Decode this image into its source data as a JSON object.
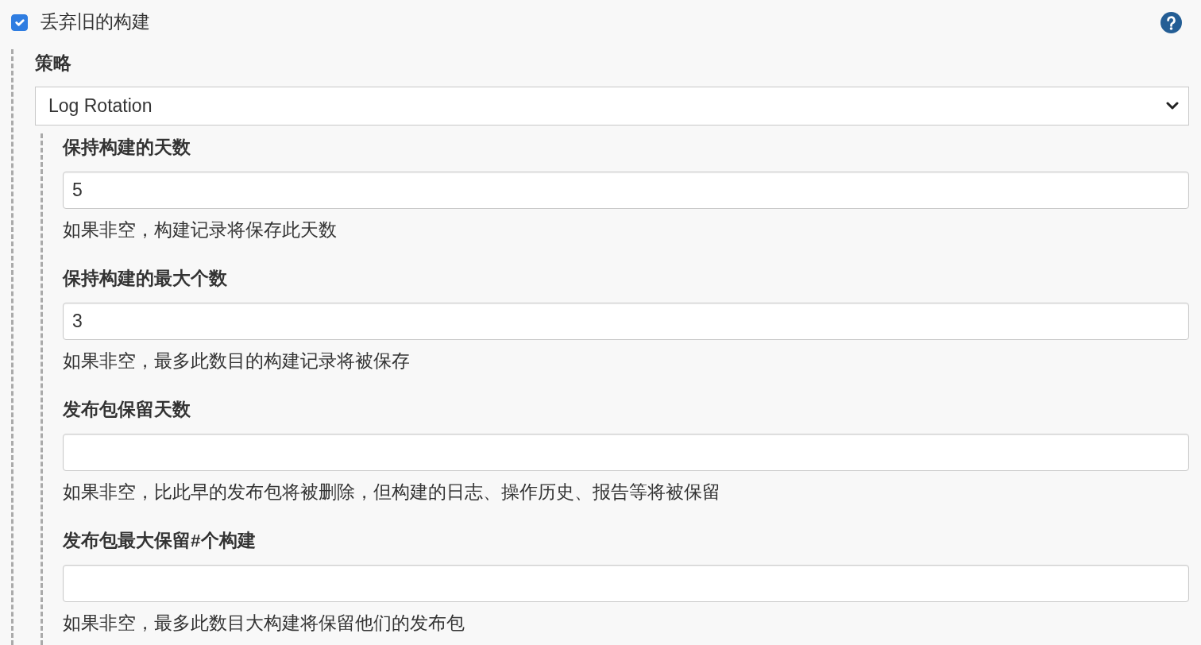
{
  "discard_old_builds": {
    "label": "丢弃旧的构建",
    "checked": true
  },
  "strategy": {
    "label": "策略",
    "value": "Log Rotation"
  },
  "fields": [
    {
      "label": "保持构建的天数",
      "value": "5",
      "help": "如果非空，构建记录将保存此天数"
    },
    {
      "label": "保持构建的最大个数",
      "value": "3",
      "help": "如果非空，最多此数目的构建记录将被保存"
    },
    {
      "label": "发布包保留天数",
      "help": "如果非空，比此早的发布包将被删除，但构建的日志、操作历史、报告等将被保留"
    },
    {
      "label": "发布包最大保留#个构建",
      "help": "如果非空，最多此数目大构建将保留他们的发布包"
    }
  ]
}
